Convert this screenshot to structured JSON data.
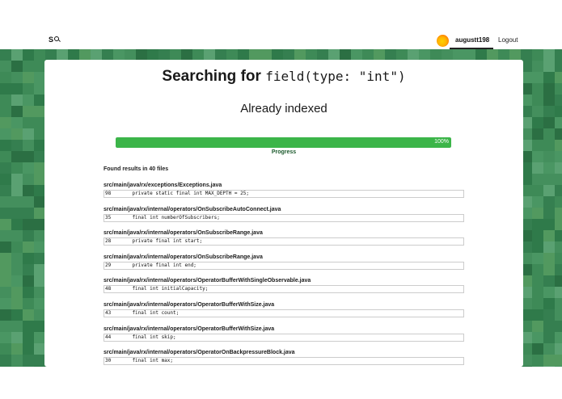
{
  "header": {
    "logo_text": "S",
    "username": "augustt198",
    "logout_label": "Logout"
  },
  "search": {
    "prefix": "Searching for",
    "query": "field(type: \"int\")",
    "status": "Already indexed"
  },
  "progress": {
    "value_percent": 100,
    "percent_label": "100%",
    "label": "Progress"
  },
  "results": {
    "summary": "Found results in 40 files",
    "items": [
      {
        "path": "src/main/java/rx/exceptions/Exceptions.java",
        "line": "98",
        "code": "    private static final int MAX_DEPTH = 25;"
      },
      {
        "path": "src/main/java/rx/internal/operators/OnSubscribeAutoConnect.java",
        "line": "35",
        "code": "    final int numberOfSubscribers;"
      },
      {
        "path": "src/main/java/rx/internal/operators/OnSubscribeRange.java",
        "line": "28",
        "code": "    private final int start;"
      },
      {
        "path": "src/main/java/rx/internal/operators/OnSubscribeRange.java",
        "line": "29",
        "code": "    private final int end;"
      },
      {
        "path": "src/main/java/rx/internal/operators/OperatorBufferWithSingleObservable.java",
        "line": "48",
        "code": "    final int initialCapacity;"
      },
      {
        "path": "src/main/java/rx/internal/operators/OperatorBufferWithSize.java",
        "line": "43",
        "code": "    final int count;"
      },
      {
        "path": "src/main/java/rx/internal/operators/OperatorBufferWithSize.java",
        "line": "44",
        "code": "    final int skip;"
      },
      {
        "path": "src/main/java/rx/internal/operators/OperatorOnBackpressureBlock.java",
        "line": "30",
        "code": "    final int max;"
      }
    ]
  },
  "colors": {
    "progress_fill": "#3cb549",
    "mosaic_base": "#3e8a57"
  }
}
